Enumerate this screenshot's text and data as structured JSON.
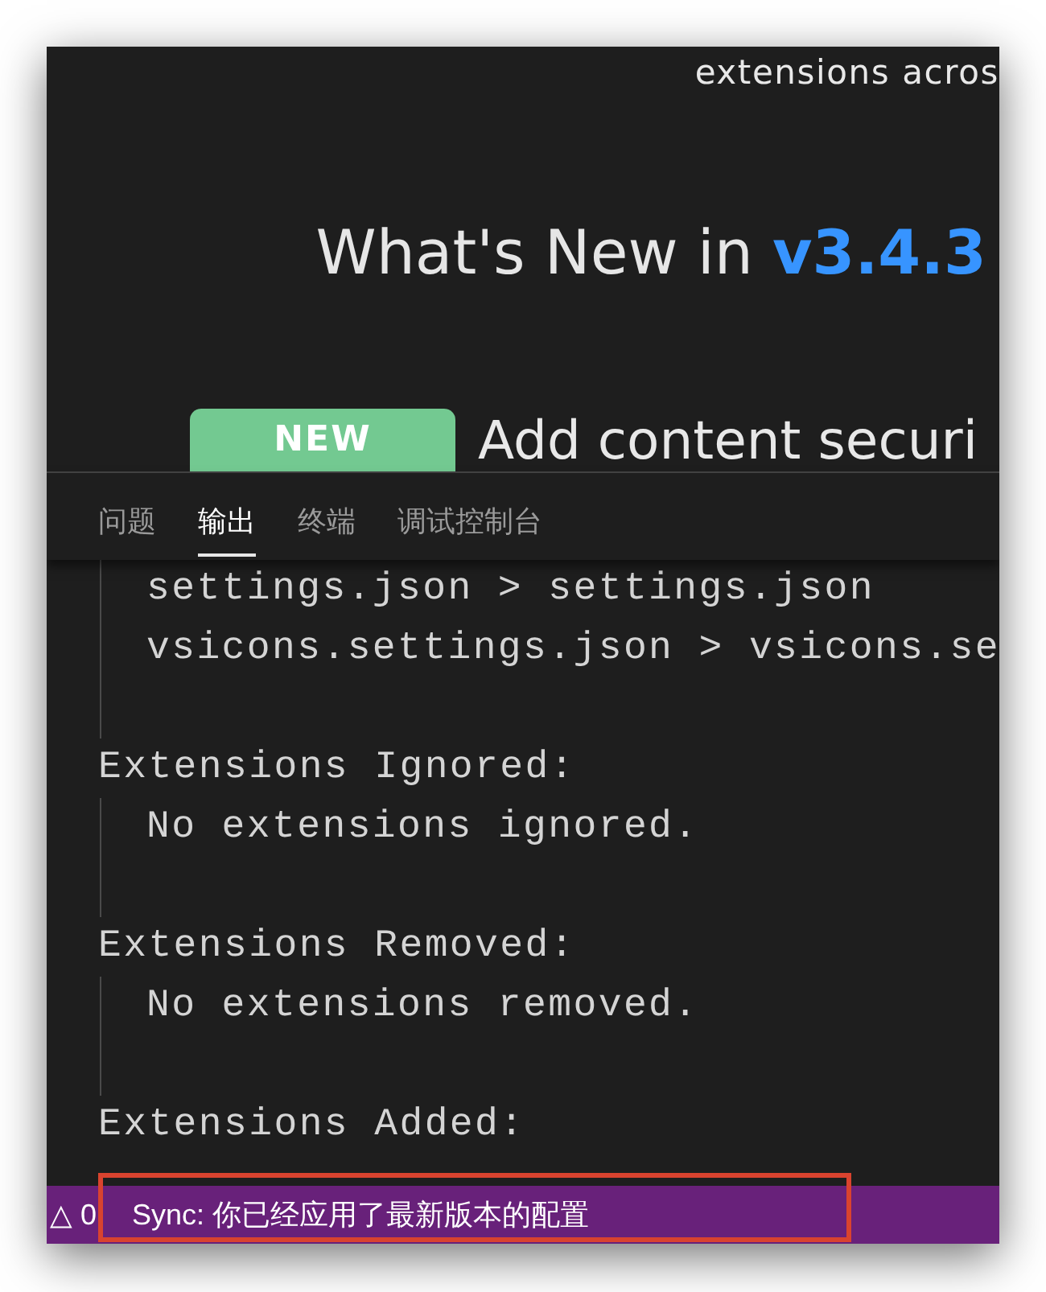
{
  "editor": {
    "intro_text": "extensions acros",
    "heading": "What's New in",
    "version": "v3.4.3",
    "badge": "NEW",
    "item_text": "Add content securi"
  },
  "panel": {
    "tabs": [
      {
        "label": "问题",
        "selected": false
      },
      {
        "label": "输出",
        "selected": true
      },
      {
        "label": "终端",
        "selected": false
      },
      {
        "label": "调试控制台",
        "selected": false
      }
    ],
    "output": [
      {
        "lines": [
          "settings.json > settings.json",
          "vsicons.settings.json > vsicons.se"
        ]
      },
      {
        "heading": "Extensions Ignored:",
        "lines": [
          "No extensions ignored."
        ]
      },
      {
        "heading": "Extensions Removed:",
        "lines": [
          "No extensions removed."
        ]
      },
      {
        "heading": "Extensions Added:"
      }
    ]
  },
  "status_bar": {
    "problems": "△ 0",
    "message": "Sync: 你已经应用了最新版本的配置",
    "highlighted": true
  }
}
